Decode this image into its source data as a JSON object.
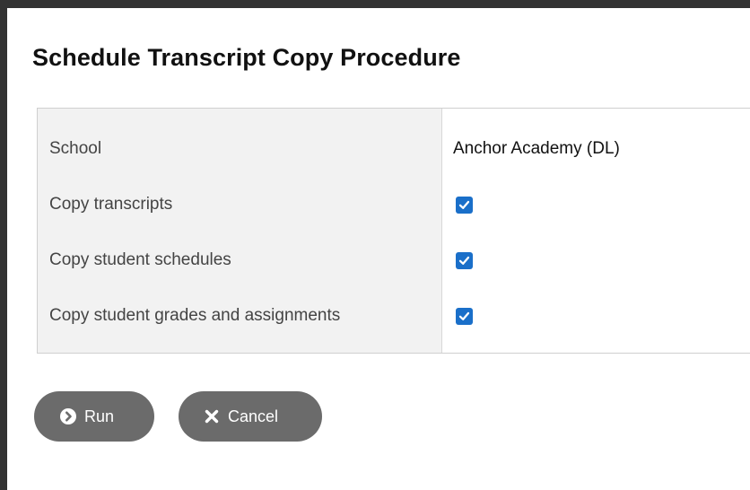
{
  "dialog": {
    "title": "Schedule Transcript Copy Procedure"
  },
  "form": {
    "rows": [
      {
        "label": "School",
        "value": "Anchor Academy (DL)"
      },
      {
        "label": "Copy transcripts",
        "checked": true
      },
      {
        "label": "Copy student schedules",
        "checked": true
      },
      {
        "label": "Copy student grades and assignments",
        "checked": true
      }
    ]
  },
  "buttons": {
    "run_label": "Run",
    "run_icon": "chevron-right-circle-icon",
    "cancel_label": "Cancel",
    "cancel_icon": "x-icon"
  },
  "colors": {
    "accent": "#1a6fc9",
    "button_bg": "#6b6b6b",
    "label_bg": "#f2f2f2"
  }
}
